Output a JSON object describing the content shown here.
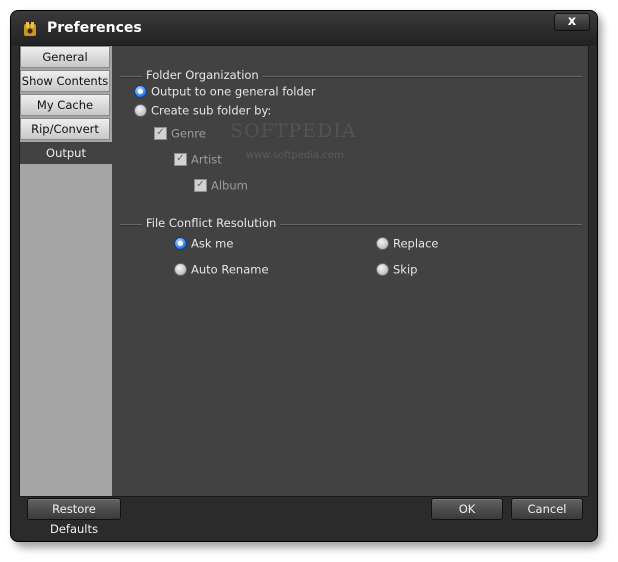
{
  "window": {
    "title": "Preferences",
    "close_label": "x"
  },
  "watermark": {
    "text": "SOFTPEDIA",
    "sub": "www.softpedia.com"
  },
  "sidebar": {
    "tabs": [
      {
        "label": "General"
      },
      {
        "label": "Show Contents"
      },
      {
        "label": "My Cache"
      },
      {
        "label": "Rip/Convert"
      },
      {
        "label": "Output"
      }
    ],
    "active": "Output"
  },
  "folder_organization": {
    "title": "Folder Organization",
    "options": [
      {
        "label": "Output to one general folder",
        "selected": true
      },
      {
        "label": "Create sub folder by:",
        "selected": false
      }
    ],
    "subfolders": [
      {
        "label": "Genre",
        "checked": true
      },
      {
        "label": "Artist",
        "checked": true
      },
      {
        "label": "Album",
        "checked": true
      }
    ]
  },
  "conflict_resolution": {
    "title": "File Conflict Resolution",
    "options": [
      {
        "label": "Ask me",
        "selected": true
      },
      {
        "label": "Replace",
        "selected": false
      },
      {
        "label": "Auto Rename",
        "selected": false
      },
      {
        "label": "Skip",
        "selected": false
      }
    ]
  },
  "footer": {
    "restore_label": "Restore Defaults",
    "ok_label": "OK",
    "cancel_label": "Cancel"
  },
  "colors": {
    "accent": "#2f7fe0",
    "panel": "#424242",
    "sidebar": "#a5a5a5"
  }
}
